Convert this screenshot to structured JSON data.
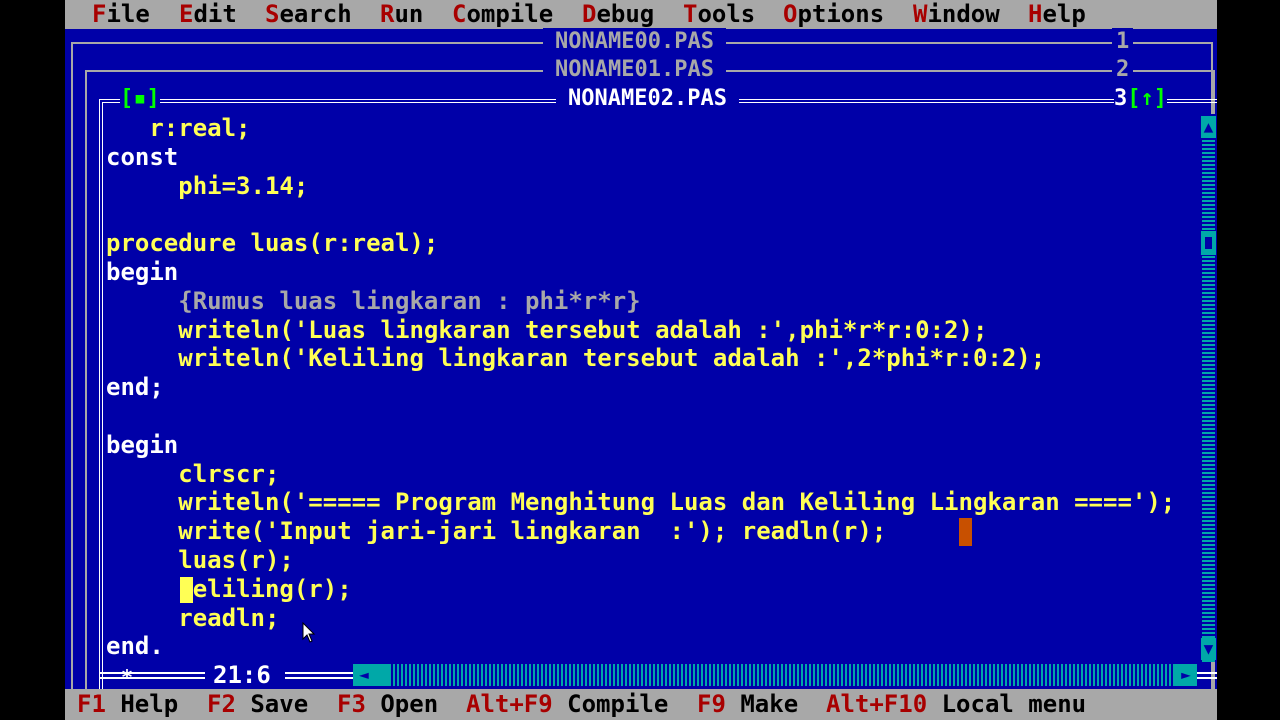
{
  "menu": [
    {
      "hotkey": "F",
      "rest": "ile"
    },
    {
      "hotkey": "E",
      "rest": "dit"
    },
    {
      "hotkey": "S",
      "rest": "earch"
    },
    {
      "hotkey": "R",
      "rest": "un"
    },
    {
      "hotkey": "C",
      "rest": "ompile"
    },
    {
      "hotkey": "D",
      "rest": "ebug"
    },
    {
      "hotkey": "T",
      "rest": "ools"
    },
    {
      "hotkey": "O",
      "rest": "ptions"
    },
    {
      "hotkey": "W",
      "rest": "indow"
    },
    {
      "hotkey": "H",
      "rest": "elp"
    }
  ],
  "windows": [
    {
      "title": "NONAME00.PAS",
      "number": "1"
    },
    {
      "title": "NONAME01.PAS",
      "number": "2"
    }
  ],
  "active_window": {
    "title": "NONAME02.PAS",
    "number": "3",
    "close_box": "[▪]",
    "zoom_box": "[↑]",
    "cursor_position": "21:6"
  },
  "code_lines": [
    {
      "indent": "   ",
      "text": "r:real;",
      "kind": "code"
    },
    {
      "indent": "",
      "text": "const",
      "kind": "keyword"
    },
    {
      "indent": "     ",
      "text": "phi=3.14;",
      "kind": "code"
    },
    {
      "indent": "",
      "text": "",
      "kind": "code"
    },
    {
      "indent": "",
      "text": "procedure luas(r:real);",
      "kind": "code"
    },
    {
      "indent": "",
      "text": "begin",
      "kind": "keyword"
    },
    {
      "indent": "     ",
      "text": "{Rumus luas lingkaran : phi*r*r}",
      "kind": "comment"
    },
    {
      "indent": "     ",
      "text": "writeln('Luas lingkaran tersebut adalah :',phi*r*r:0:2);",
      "kind": "code"
    },
    {
      "indent": "     ",
      "text": "writeln('Keliling lingkaran tersebut adalah :',2*phi*r:0:2);",
      "kind": "code"
    },
    {
      "indent": "",
      "text": "end;",
      "kind": "keyword"
    },
    {
      "indent": "",
      "text": "",
      "kind": "code"
    },
    {
      "indent": "",
      "text": "begin",
      "kind": "keyword"
    },
    {
      "indent": "     ",
      "text": "clrscr;",
      "kind": "code"
    },
    {
      "indent": "     ",
      "text": "writeln('===== Program Menghitung Luas dan Keliling Lingkaran ====');",
      "kind": "code"
    },
    {
      "indent": "     ",
      "text": "write('Input jari-jari lingkaran  :'); readln(r);",
      "kind": "code"
    },
    {
      "indent": "     ",
      "text": "luas(r);",
      "kind": "code"
    },
    {
      "indent": "     ",
      "text": "keliling(r);",
      "kind": "code"
    },
    {
      "indent": "     ",
      "text": "readln;",
      "kind": "code"
    },
    {
      "indent": "",
      "text": "end.",
      "kind": "keyword"
    }
  ],
  "status": [
    {
      "key": "F1",
      "label": "Help"
    },
    {
      "key": "F2",
      "label": "Save"
    },
    {
      "key": "F3",
      "label": "Open"
    },
    {
      "key": "Alt+F9",
      "label": "Compile"
    },
    {
      "key": "F9",
      "label": "Make"
    },
    {
      "key": "Alt+F10",
      "label": "Local menu"
    }
  ],
  "colors": {
    "background": "#0000a8",
    "menu_bg": "#a8a8a8",
    "hotkey": "#a80000",
    "code": "#ffff55",
    "keyword": "#ffffff",
    "comment": "#a8a8a8",
    "scrollbar": "#00a8a8"
  }
}
